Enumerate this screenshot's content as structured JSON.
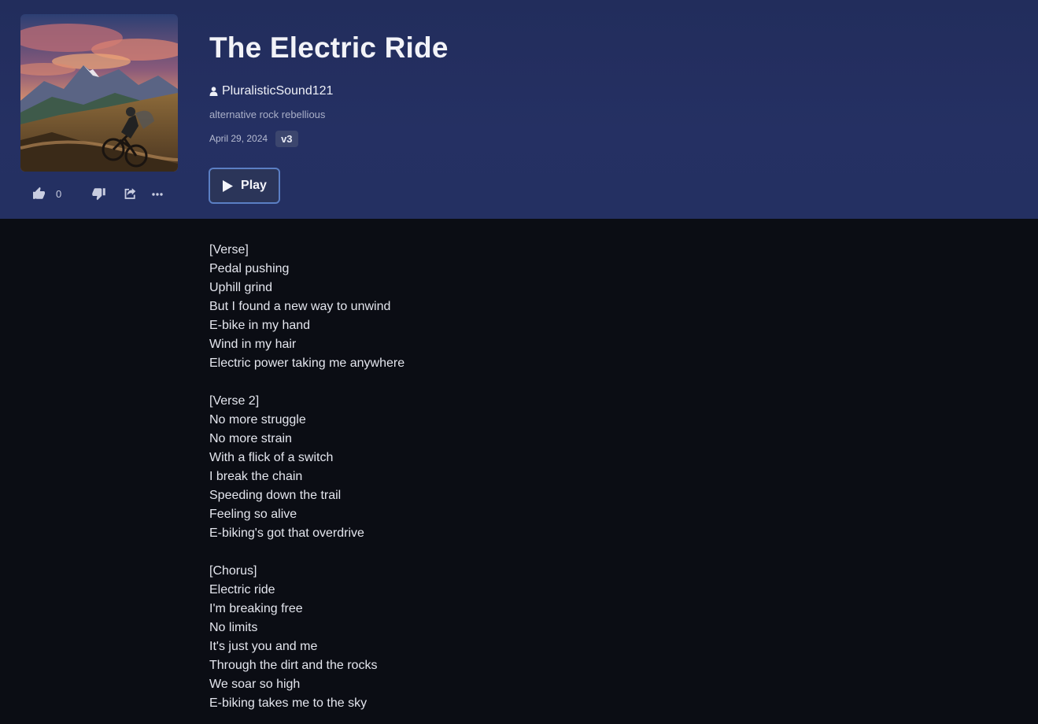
{
  "song": {
    "title": "The Electric Ride",
    "artist": "PluralisticSound121",
    "tags": "alternative rock rebellious",
    "date": "April 29, 2024",
    "version": "v3",
    "play_label": "Play",
    "like_count": "0"
  },
  "icons": {
    "like": "thumbs-up-icon",
    "dislike": "thumbs-down-icon",
    "share": "share-icon",
    "more": "more-icon",
    "artist": "user-icon",
    "play": "play-icon"
  },
  "colors": {
    "header_bg": "#243062",
    "page_bg": "#0b0d14",
    "play_border": "#5b7fc4",
    "badge_bg": "#3c466e"
  },
  "lyrics": {
    "section1": {
      "tag": "[Verse]",
      "lines": [
        "Pedal pushing",
        "Uphill grind",
        "But I found a new way to unwind",
        "E-bike in my hand",
        "Wind in my hair",
        "Electric power taking me anywhere"
      ]
    },
    "section2": {
      "tag": "[Verse 2]",
      "lines": [
        "No more struggle",
        "No more strain",
        "With a flick of a switch",
        "I break the chain",
        "Speeding down the trail",
        "Feeling so alive",
        "E-biking's got that overdrive"
      ]
    },
    "section3": {
      "tag": "[Chorus]",
      "lines": [
        "Electric ride",
        "I'm breaking free",
        "No limits",
        "It's just you and me",
        "Through the dirt and the rocks",
        "We soar so high",
        "E-biking takes me to the sky"
      ]
    }
  }
}
